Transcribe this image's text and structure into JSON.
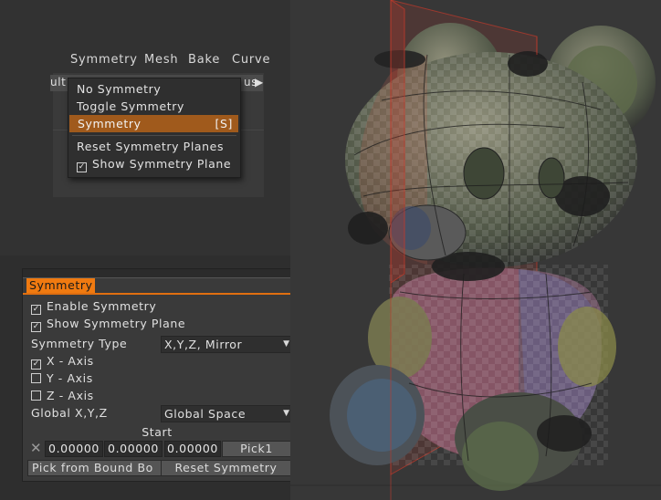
{
  "menubar": {
    "items": [
      "Symmetry",
      "Mesh",
      "Bake",
      "Curve"
    ]
  },
  "background_toolbar": {
    "left_fragment": "ult",
    "right_fragment": "us"
  },
  "symmetry_menu": {
    "items": [
      {
        "label": "No  Symmetry"
      },
      {
        "label": "Toggle  Symmetry"
      },
      {
        "label": "Symmetry",
        "shortcut": "[S]",
        "highlighted": true
      },
      {
        "label": "Reset  Symmetry  Planes"
      },
      {
        "label": "Show  Symmetry  Plane",
        "checked": true
      }
    ]
  },
  "symmetry_panel": {
    "tab_label": "Symmetry",
    "enable_symmetry": {
      "label": "Enable  Symmetry",
      "checked": true
    },
    "show_symmetry_plane": {
      "label": "Show  Symmetry  Plane",
      "checked": true
    },
    "symmetry_type": {
      "label": "Symmetry  Type",
      "value": "X,Y,Z,  Mirror"
    },
    "x_axis": {
      "label": "X  -  Axis",
      "checked": true
    },
    "y_axis": {
      "label": "Y  -  Axis",
      "checked": false
    },
    "z_axis": {
      "label": "Z  -  Axis",
      "checked": false
    },
    "global_xyz": {
      "label": "Global  X,Y,Z",
      "value": "Global  Space"
    },
    "start_label": "Start",
    "start_values": [
      "0.00000",
      "0.00000",
      "0.00000"
    ],
    "pick_button": "Pick1",
    "pick_from_bound_box_button": "Pick  from  Bound  Bo",
    "reset_symmetry_button": "Reset  Symmetry"
  },
  "colors": {
    "accent_orange": "#f07a10",
    "menu_highlight": "#a05a1c",
    "symmetry_plane": "#c0392b"
  },
  "icons": {
    "check": "check-icon",
    "dropdown": "chevron-down-icon",
    "clear": "close-icon"
  }
}
